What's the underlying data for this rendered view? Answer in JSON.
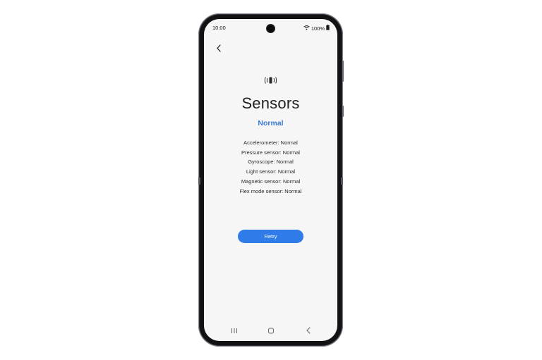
{
  "status_bar": {
    "time": "10:00",
    "battery": "100%"
  },
  "icons": {
    "back": "chevron-left-icon",
    "sensor": "vibration-sensor-icon",
    "nav_recents": "recents-icon",
    "nav_home": "home-icon",
    "nav_back": "back-icon"
  },
  "page": {
    "title": "Sensors",
    "status": "Normal",
    "results": [
      "Accelerometer: Normal",
      "Pressure sensor: Normal",
      "Gyroscope: Normal",
      "Light sensor: Normal",
      "Magnetic sensor: Normal",
      "Flex mode sensor: Normal"
    ],
    "retry_label": "Retry"
  },
  "colors": {
    "accent": "#3a7bd5",
    "button": "#2f7ce8",
    "screen_bg": "#f6f6f6",
    "frame": "#2f2c33"
  }
}
